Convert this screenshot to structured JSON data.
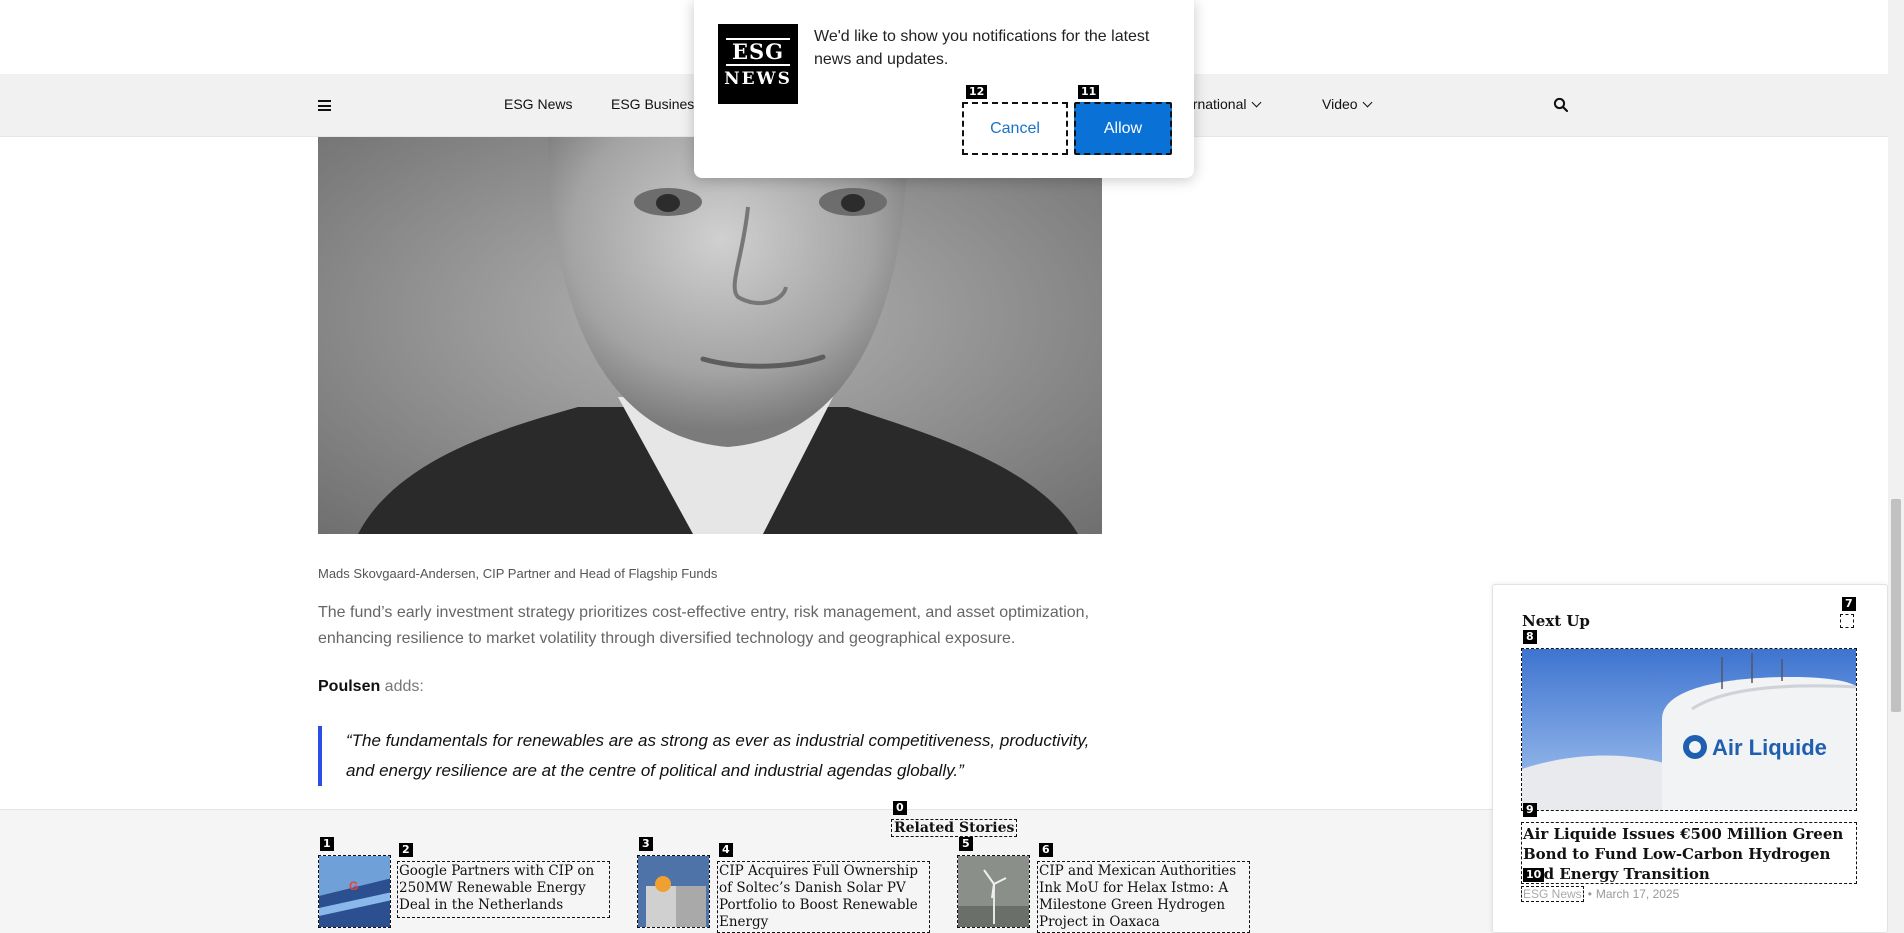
{
  "nav": {
    "items": [
      {
        "label": "ESG News",
        "has_dropdown": false
      },
      {
        "label": "ESG Business",
        "has_dropdown": false
      },
      {
        "label": "ernational",
        "has_dropdown": true
      },
      {
        "label": "Video",
        "has_dropdown": true
      }
    ],
    "menu_icon": "hamburger-icon",
    "search_icon": "search-icon"
  },
  "popup": {
    "logo_line1": "ESG",
    "logo_line2": "NEWS",
    "message": "We'd like to show you notifications for the latest news and updates.",
    "cancel_label": "Cancel",
    "allow_label": "Allow",
    "cancel_tag": "12",
    "allow_tag": "11"
  },
  "article": {
    "caption": "Mads Skovgaard-Andersen, CIP Partner and Head of Flagship Funds",
    "paragraph": "The fund’s early investment strategy prioritizes cost-effective entry, risk management, and asset optimization, enhancing resilience to market volatility through diversified technology and geographical exposure.",
    "speaker": "Poulsen",
    "speaker_suffix": " adds:",
    "quote": "“The fundamentals for renewables are as strong as ever as industrial competitiveness, productivity, and energy resilience are at the centre of political and industrial agendas globally.”"
  },
  "related": {
    "title": "Related Stories",
    "title_tag": "0",
    "items": [
      {
        "thumb_tag": "1",
        "title_tag": "2",
        "title": "Google Partners with CIP on 250MW Renewable Energy Deal in the Netherlands"
      },
      {
        "thumb_tag": "3",
        "title_tag": "4",
        "title": "CIP Acquires Full Ownership of Soltec’s Danish Solar PV Portfolio to Boost Renewable Energy"
      },
      {
        "thumb_tag": "5",
        "title_tag": "6",
        "title": "CIP and Mexican Authorities Ink MoU for Helax Istmo: A Milestone Green Hydrogen Project in Oaxaca"
      }
    ]
  },
  "next_up": {
    "heading": "Next Up",
    "expand_tag": "7",
    "image_tag": "8",
    "headline_tag": "9",
    "category_tag": "10",
    "image_brand": "Air Liquide",
    "headline": "Air Liquide Issues €500 Million Green Bond to Fund Low-Carbon Hydrogen and Energy Transition",
    "category": "ESG News",
    "separator": "•",
    "date": "March 17, 2025"
  }
}
